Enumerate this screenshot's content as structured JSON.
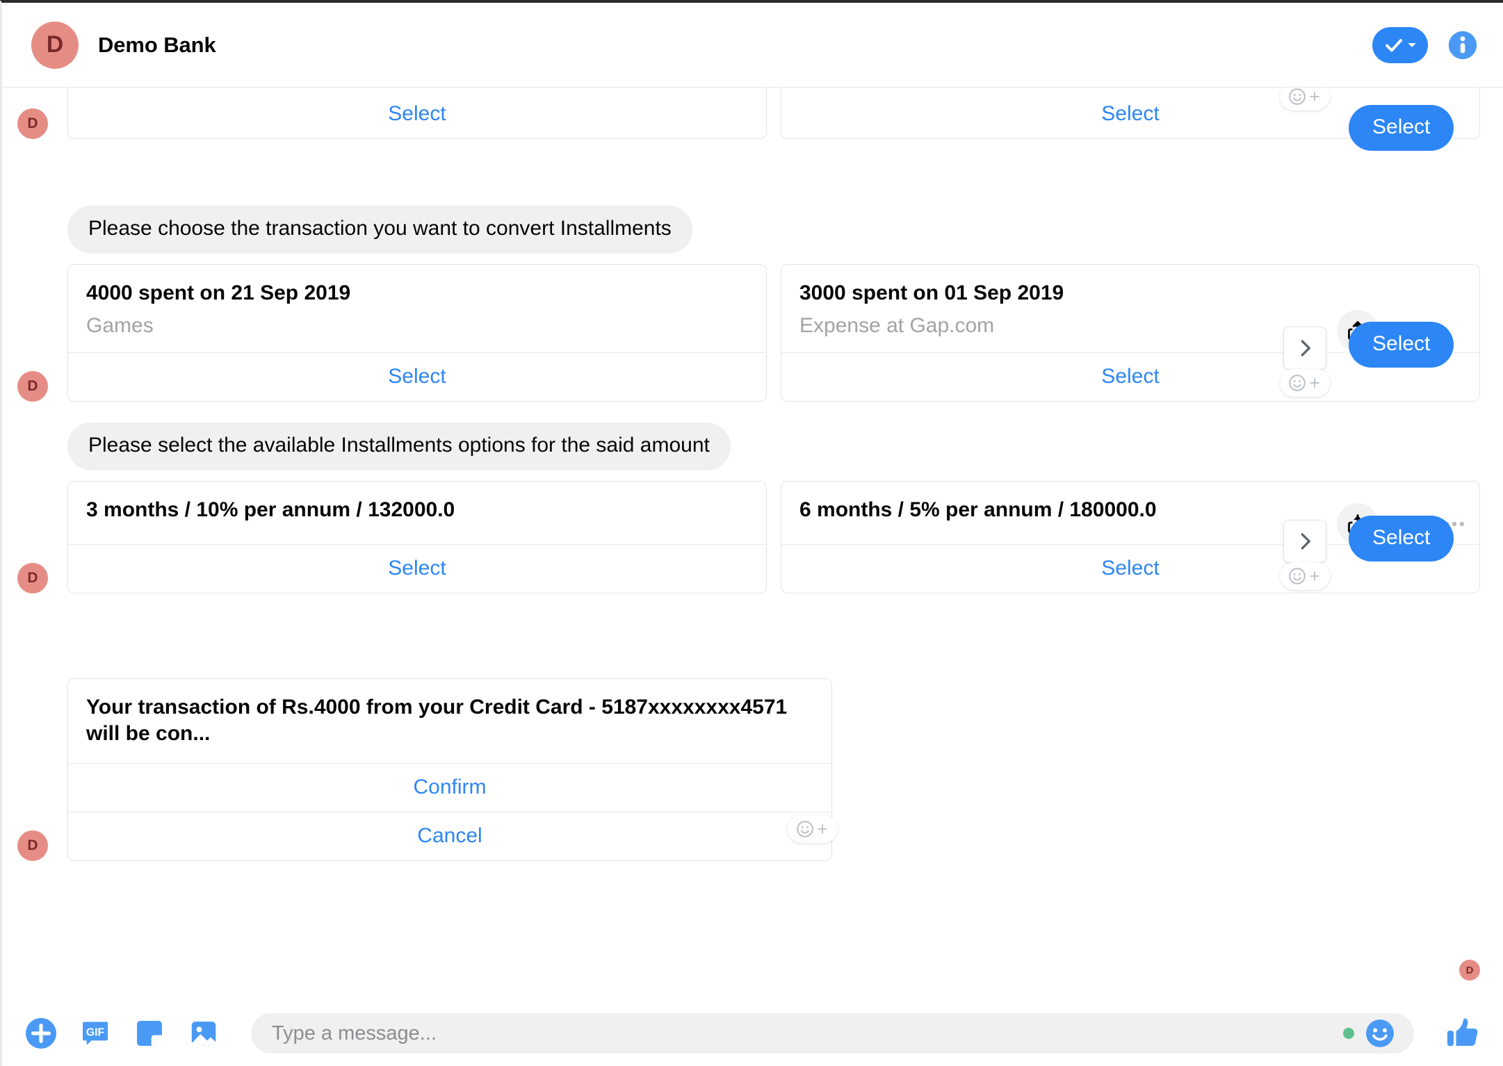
{
  "header": {
    "avatar_initial": "D",
    "title": "Demo Bank",
    "check_icon": "checkmark-dropdown-icon",
    "info_icon": "info-icon",
    "accent_color": "#2c86f5",
    "avatar_color": "#e58d85"
  },
  "thread": {
    "avatar_initial": "D",
    "select_label": "Select",
    "confirm_label": "Confirm",
    "cancel_label": "Cancel",
    "messages": [
      {
        "type": "carousel-clipped",
        "cards": [
          {
            "select": "Select"
          },
          {
            "select": "Select"
          }
        ],
        "reply_pill": "Select"
      },
      {
        "type": "bubble-carousel",
        "bubble": "Please choose the transaction you want to convert Installments",
        "cards": [
          {
            "title": "4000 spent on 21 Sep 2019",
            "subtitle": "Games",
            "select": "Select"
          },
          {
            "title": "3000 spent on 01 Sep 2019",
            "subtitle": "Expense at Gap.com",
            "select": "Select"
          }
        ],
        "reply_pill": "Select"
      },
      {
        "type": "bubble-carousel",
        "bubble": "Please select the available Installments options for the said amount",
        "cards": [
          {
            "title": "3 months / 10% per annum / 132000.0",
            "subtitle": "",
            "select": "Select"
          },
          {
            "title": "6 months / 5% per annum / 180000.0",
            "subtitle": "",
            "select": "Select"
          }
        ],
        "reply_pill": "Select"
      },
      {
        "type": "confirm-card",
        "title": "Your transaction of Rs.4000 from your Credit Card - 5187xxxxxxxx4571 will be con...",
        "confirm": "Confirm",
        "cancel": "Cancel"
      }
    ],
    "seen_avatar": "D"
  },
  "composer": {
    "placeholder": "Type a message...",
    "value": "",
    "icons": [
      "plus-circle-icon",
      "gif-icon",
      "sticker-icon",
      "photo-icon"
    ],
    "gif_label": "GIF",
    "emoji_icon": "emoji-smiley-icon",
    "thumbs_icon": "thumbs-up-icon",
    "accent_color": "#4a9af5"
  }
}
